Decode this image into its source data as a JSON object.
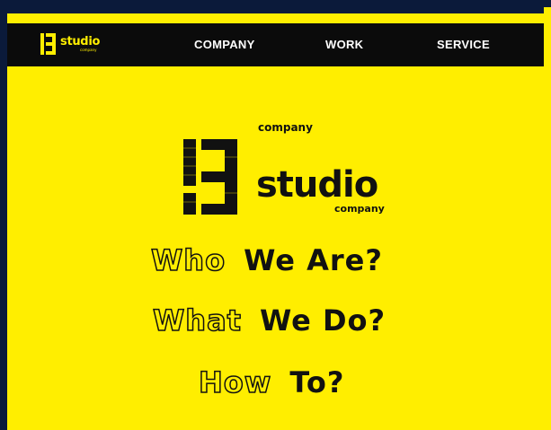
{
  "brand": {
    "logo_word": "studio",
    "logo_sub": "company",
    "accent_color": "#ffee00",
    "nav_bg": "#0b0b0b"
  },
  "nav": {
    "items": [
      {
        "label": "COMPANY"
      },
      {
        "label": "WORK"
      },
      {
        "label": "SERVICE"
      }
    ]
  },
  "hero": {
    "top_text": "company",
    "word": "studio",
    "sub_text": "company",
    "mark_icon": "b-block-logo-icon"
  },
  "lines": [
    {
      "outline": "Who",
      "solid": "We Are?"
    },
    {
      "outline": "What",
      "solid": "We Do?"
    },
    {
      "outline": "How",
      "solid": "To?"
    }
  ]
}
